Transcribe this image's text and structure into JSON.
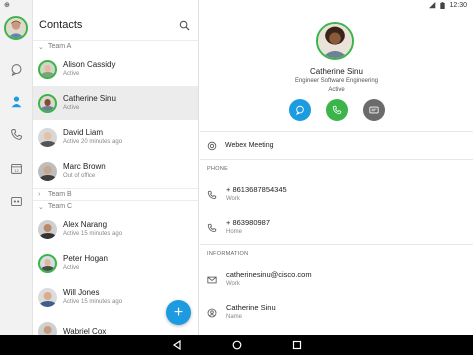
{
  "status_bar": {
    "time": "12:30",
    "left_glyph": "⊕"
  },
  "rail": {
    "items": [
      {
        "icon": "chat-bubble-icon"
      },
      {
        "icon": "person-icon"
      },
      {
        "icon": "phone-icon"
      },
      {
        "icon": "calendar-icon"
      },
      {
        "icon": "meeting-room-icon"
      }
    ]
  },
  "contacts": {
    "title": "Contacts",
    "groups": [
      {
        "label": "Team A",
        "expanded": true
      },
      {
        "label": "Team B",
        "expanded": false
      },
      {
        "label": "Team C",
        "expanded": true
      }
    ],
    "team_a": [
      {
        "name": "Alison Cassidy",
        "status": "Active"
      },
      {
        "name": "Catherine Sinu",
        "status": "Active"
      },
      {
        "name": "David Liam",
        "status": "Active 20 minutes ago"
      },
      {
        "name": "Marc Brown",
        "status": "Out of office"
      }
    ],
    "team_c": [
      {
        "name": "Alex Narang",
        "status": "Active 15 minutes ago"
      },
      {
        "name": "Peter Hogan",
        "status": "Active"
      },
      {
        "name": "Will Jones",
        "status": "Active 15 minutes ago"
      },
      {
        "name": "Wabriel Cox",
        "status": ""
      }
    ],
    "fab_label": "+"
  },
  "detail": {
    "name": "Catherine Sinu",
    "title": "Engineer Software Engineering",
    "status": "Active",
    "meeting_label": "Webex Meeting",
    "phone_section": "PHONE",
    "phones": [
      {
        "value": "+ 8613687854345",
        "label": "Work"
      },
      {
        "value": "+ 863980987",
        "label": "Home"
      }
    ],
    "info_section": "INFORMATION",
    "info": [
      {
        "value": "catherinesinu@cisco.com",
        "label": "Work",
        "icon": "mail-icon"
      },
      {
        "value": "Catherine Sinu",
        "label": "Name",
        "icon": "person-circle-icon"
      }
    ]
  },
  "colors": {
    "accent": "#1c9be0",
    "green": "#3bb54a",
    "grey_button": "#6b6b6b"
  }
}
